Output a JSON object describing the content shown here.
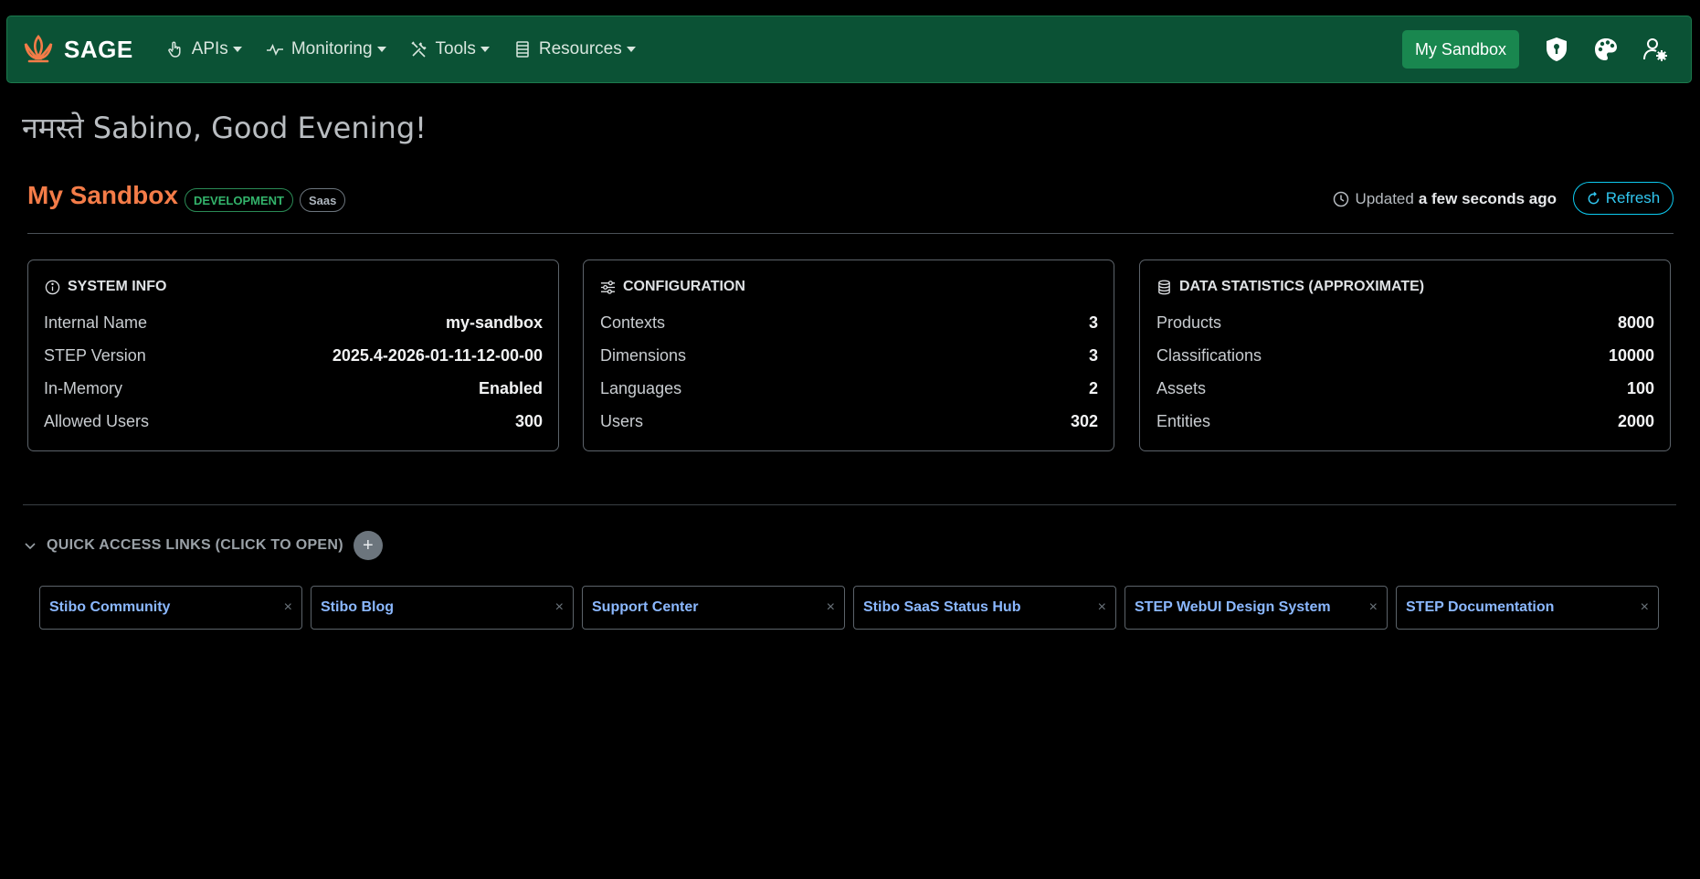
{
  "navbar": {
    "brand": "SAGE",
    "menu": [
      {
        "label": "APIs",
        "icon": "hand-pointer-icon"
      },
      {
        "label": "Monitoring",
        "icon": "activity-icon"
      },
      {
        "label": "Tools",
        "icon": "tools-icon"
      },
      {
        "label": "Resources",
        "icon": "list-icon"
      }
    ],
    "sandbox_button": "My Sandbox",
    "right_icons": [
      "shield-icon",
      "palette-icon",
      "user-gear-icon"
    ]
  },
  "greeting": "नमस्ते Sabino, Good Evening!",
  "sandbox": {
    "title": "My Sandbox",
    "badges": [
      "DEVELOPMENT",
      "Saas"
    ],
    "updated_prefix": "Updated",
    "updated_time": "a few seconds ago",
    "refresh_label": "Refresh"
  },
  "cards": [
    {
      "title": "SYSTEM INFO",
      "icon": "info-icon",
      "rows": [
        {
          "label": "Internal Name",
          "value": "my-sandbox"
        },
        {
          "label": "STEP Version",
          "value": "2025.4-2026-01-11-12-00-00"
        },
        {
          "label": "In-Memory",
          "value": "Enabled"
        },
        {
          "label": "Allowed Users",
          "value": "300"
        }
      ]
    },
    {
      "title": "CONFIGURATION",
      "icon": "sliders-icon",
      "rows": [
        {
          "label": "Contexts",
          "value": "3"
        },
        {
          "label": "Dimensions",
          "value": "3"
        },
        {
          "label": "Languages",
          "value": "2"
        },
        {
          "label": "Users",
          "value": "302"
        }
      ]
    },
    {
      "title": "DATA STATISTICS (APPROXIMATE)",
      "icon": "database-icon",
      "rows": [
        {
          "label": "Products",
          "value": "8000"
        },
        {
          "label": "Classifications",
          "value": "10000"
        },
        {
          "label": "Assets",
          "value": "100"
        },
        {
          "label": "Entities",
          "value": "2000"
        }
      ]
    }
  ],
  "quick_access": {
    "title": "QUICK ACCESS LINKS (CLICK TO OPEN)",
    "add_label": "+",
    "links": [
      {
        "label": "Stibo Community",
        "close": "×"
      },
      {
        "label": "Stibo Blog",
        "close": "×"
      },
      {
        "label": "Support Center",
        "close": "×"
      },
      {
        "label": "Stibo SaaS Status Hub",
        "close": "×"
      },
      {
        "label": "STEP WebUI Design System",
        "close": "×"
      },
      {
        "label": "STEP Documentation",
        "close": "×"
      }
    ]
  },
  "colors": {
    "navbar_bg": "#0b5235",
    "accent_orange": "#f47c48",
    "accent_green": "#19874f",
    "link_blue": "#8bb8ff",
    "refresh_cyan": "#0dcaf0"
  }
}
